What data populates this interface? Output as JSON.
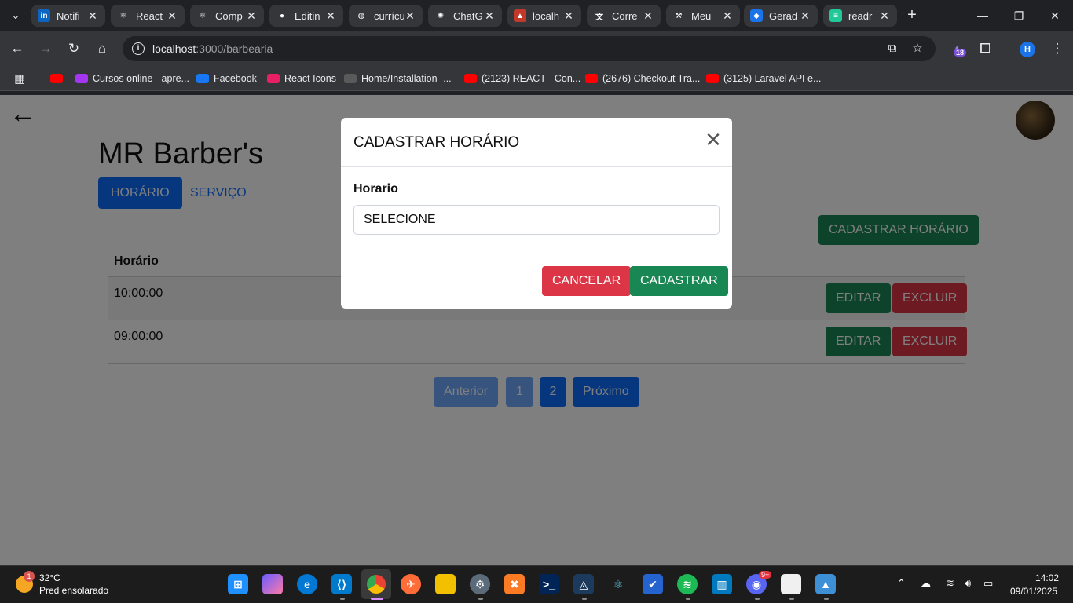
{
  "browser": {
    "tabs": [
      {
        "title": "Notifi",
        "favicon": "linkedin-icon",
        "color": "#0a66c2",
        "glyph": "in"
      },
      {
        "title": "React",
        "favicon": "react-icon",
        "color": "#35363a",
        "glyph": "⚛"
      },
      {
        "title": "Comp",
        "favicon": "react-icon",
        "color": "#35363a",
        "glyph": "⚛"
      },
      {
        "title": "Editin",
        "favicon": "github-icon",
        "color": "#35363a",
        "glyph": "●"
      },
      {
        "title": "currícu",
        "favicon": "globe-icon",
        "color": "#35363a",
        "glyph": "◍"
      },
      {
        "title": "ChatG",
        "favicon": "chatgpt-icon",
        "color": "#35363a",
        "glyph": "✺"
      },
      {
        "title": "localh",
        "favicon": "xampp-icon",
        "color": "#c0392b",
        "glyph": "▲"
      },
      {
        "title": "Corre",
        "favicon": "translate-icon",
        "color": "#35363a",
        "glyph": "文"
      },
      {
        "title": "Meu",
        "favicon": "hammer-icon",
        "color": "#35363a",
        "glyph": "⚒"
      },
      {
        "title": "Gerad",
        "favicon": "app-icon",
        "color": "#1a73e8",
        "glyph": "◆"
      },
      {
        "title": "readr",
        "favicon": "doc-icon",
        "color": "#20c997",
        "glyph": "≡"
      }
    ],
    "url_host": "localhost",
    "url_path": ":3000/barbearia",
    "extension_badge": "18",
    "profile_initial": "H",
    "bookmarks": [
      {
        "label": "",
        "icon": "youtube-icon",
        "color": "#ff0000"
      },
      {
        "label": "Cursos online - apre...",
        "icon": "udemy-icon",
        "color": "#a435f0"
      },
      {
        "label": "Facebook",
        "icon": "facebook-icon",
        "color": "#1877f2"
      },
      {
        "label": "React Icons",
        "icon": "react-icon",
        "color": "#e91e63"
      },
      {
        "label": "Home/Installation -...",
        "icon": "react-icon",
        "color": "#5a5a5a"
      },
      {
        "label": "(2123) REACT - Con...",
        "icon": "youtube-icon",
        "color": "#ff0000"
      },
      {
        "label": "(2676) Checkout Tra...",
        "icon": "youtube-icon",
        "color": "#ff0000"
      },
      {
        "label": "(3125) Laravel API e...",
        "icon": "youtube-icon",
        "color": "#ff0000"
      }
    ]
  },
  "page": {
    "title": "MR Barber's",
    "tabs": [
      "HORÁRIO",
      "SERVIÇO"
    ],
    "cadastrar_button": "CADASTRAR HORÁRIO",
    "table": {
      "header": "Horário",
      "rows": [
        {
          "time": "10:00:00",
          "edit": "EDITAR",
          "delete": "EXCLUIR"
        },
        {
          "time": "09:00:00",
          "edit": "EDITAR",
          "delete": "EXCLUIR"
        }
      ]
    },
    "pagination": {
      "prev": "Anterior",
      "pages": [
        "1",
        "2"
      ],
      "current_page": "2",
      "next": "Próximo"
    }
  },
  "modal": {
    "title": "CADASTRAR HORÁRIO",
    "field_label": "Horario",
    "select_value": "SELECIONE",
    "cancel": "CANCELAR",
    "submit": "CADASTRAR"
  },
  "taskbar": {
    "weather_temp": "32°C",
    "weather_desc": "Pred ensolarado",
    "weather_badge": "1",
    "discord_badge": "9+",
    "time": "14:02",
    "date": "09/01/2025"
  },
  "colors": {
    "primary": "#0d6efd",
    "success": "#198754",
    "danger": "#dc3545"
  }
}
